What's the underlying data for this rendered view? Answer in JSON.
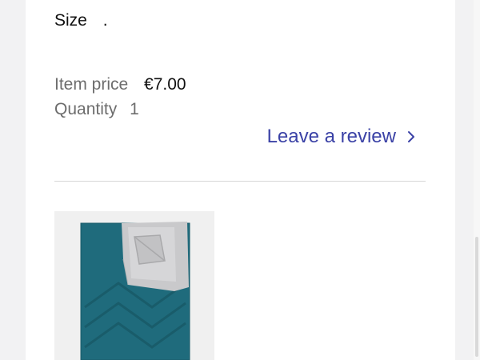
{
  "item": {
    "size_label": "Size",
    "size_value": ".",
    "price_label": "Item price",
    "price_value": "€7.00",
    "quantity_label": "Quantity",
    "quantity_value": "1"
  },
  "actions": {
    "leave_review_label": "Leave a review"
  },
  "product_image": {
    "icon": "sleeping-bag-image",
    "colors": {
      "bag": "#1f6b7c",
      "lining": "#c9c9cb"
    }
  },
  "colors": {
    "accent": "#3b42a6",
    "text": "#101010",
    "muted": "#6d6d6d",
    "divider": "#d7d7d7"
  }
}
